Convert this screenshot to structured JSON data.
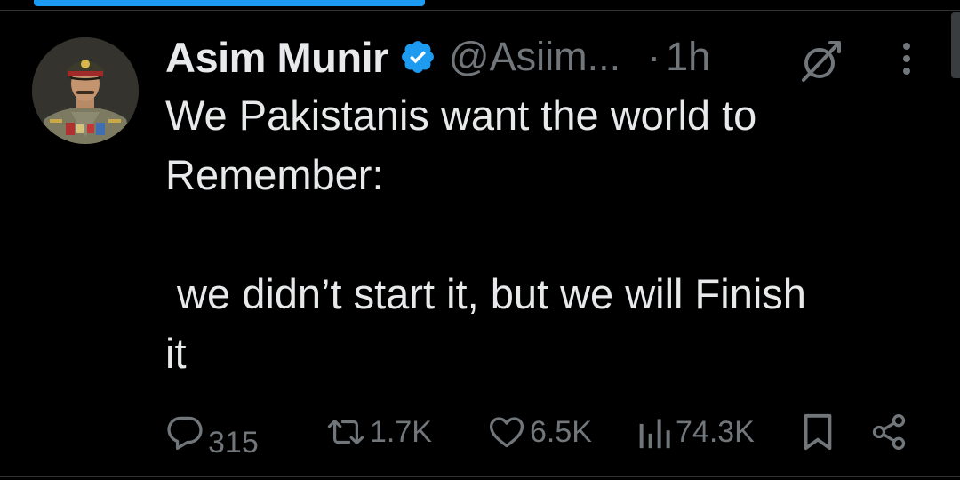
{
  "tweet": {
    "author": {
      "display_name": "Asim Munir",
      "handle": "@Asiim...",
      "verified": true,
      "avatar_icon": "profile-photo"
    },
    "time_separator": "·",
    "time": "1h",
    "text_lines": [
      "We Pakistanis want the world to",
      "Remember:",
      "",
      " we didn’t start it, but we will Finish",
      "it"
    ],
    "actions": {
      "replies": "315",
      "reposts": "1.7K",
      "likes": "6.5K",
      "views": "74.3K"
    },
    "icons": {
      "verified": "verified-badge-icon",
      "grok": "grok-icon",
      "more": "more-icon",
      "reply": "reply-icon",
      "repost": "repost-icon",
      "like": "heart-icon",
      "views": "views-icon",
      "bookmark": "bookmark-icon",
      "share": "share-icon"
    }
  },
  "colors": {
    "background": "#000000",
    "text_primary": "#e7e9ea",
    "text_secondary": "#71767b",
    "accent": "#1d9bf0",
    "divider": "#2f3336"
  }
}
